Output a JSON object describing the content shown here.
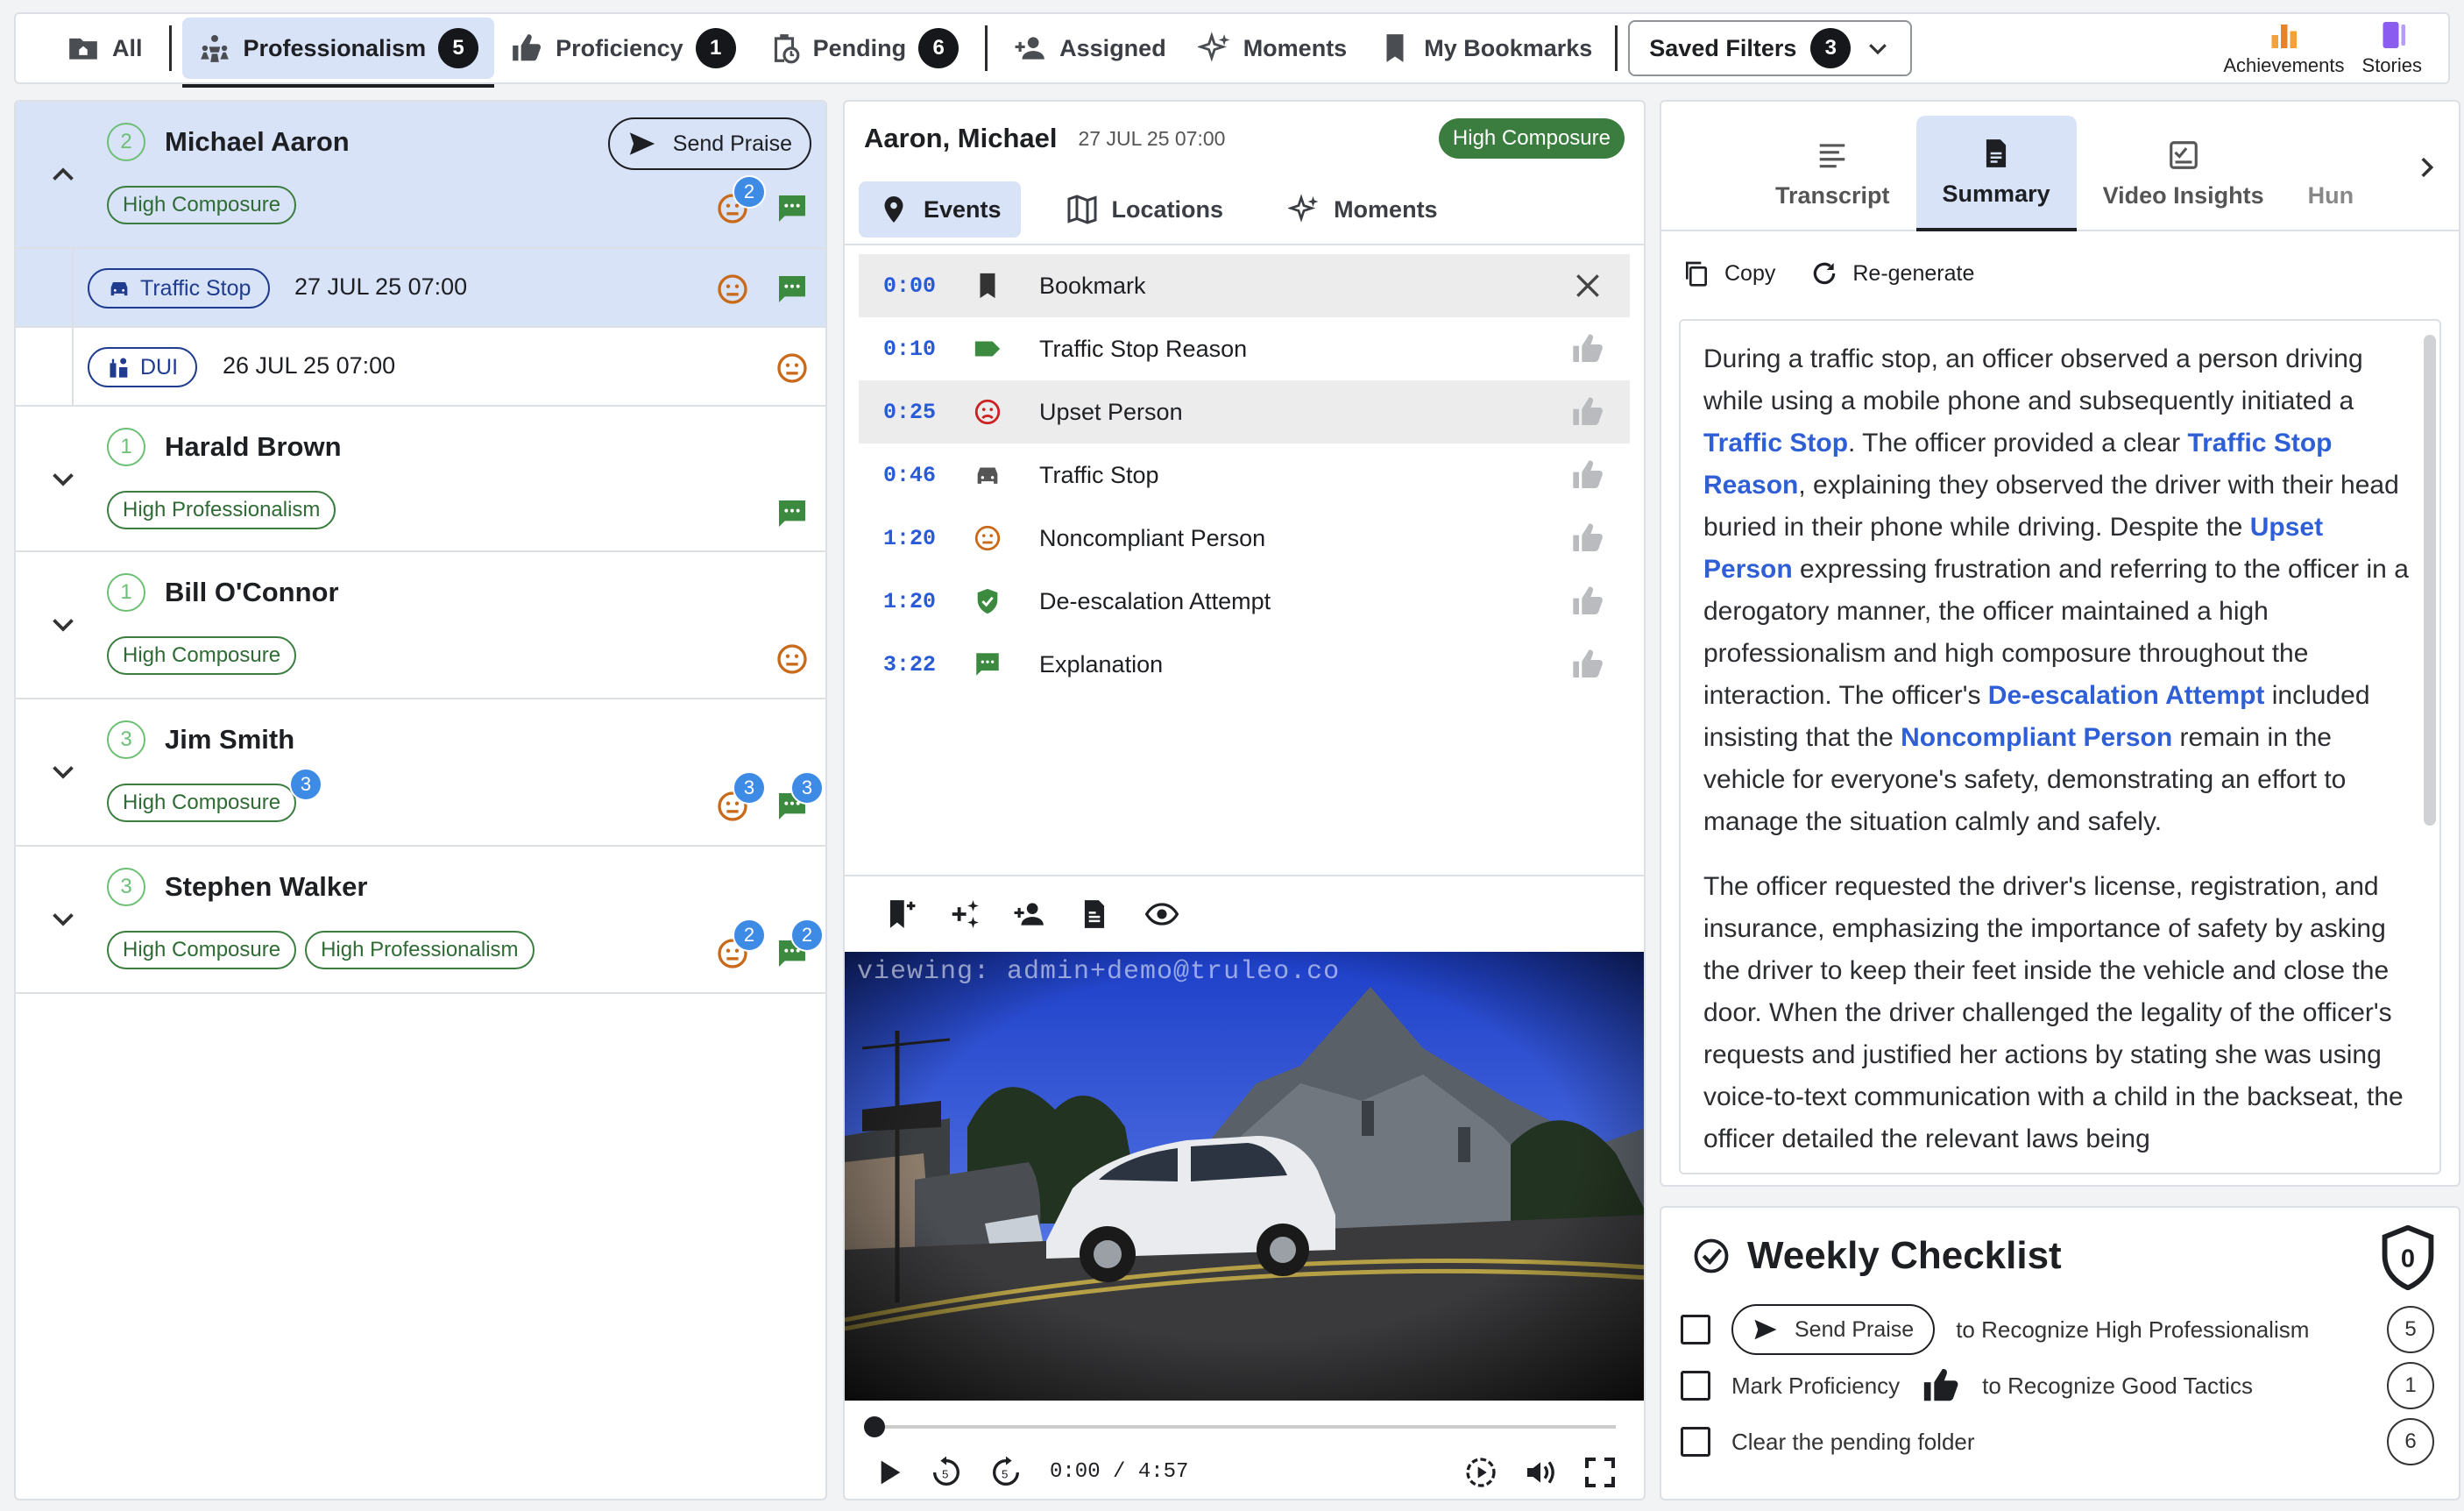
{
  "topbar": {
    "items": [
      {
        "label": "All",
        "icon": "folder-home-icon"
      },
      {
        "label": "Professionalism",
        "count": "5",
        "icon": "team-icon",
        "active": true
      },
      {
        "label": "Proficiency",
        "count": "1",
        "icon": "thumbs-up-icon"
      },
      {
        "label": "Pending",
        "count": "6",
        "icon": "clipboard-clock-icon"
      },
      {
        "label": "Assigned",
        "icon": "person-add-icon"
      },
      {
        "label": "Moments",
        "icon": "sparkle-icon"
      },
      {
        "label": "My Bookmarks",
        "icon": "bookmark-icon"
      }
    ],
    "saved_filters": {
      "label": "Saved Filters",
      "count": "3"
    },
    "right": [
      {
        "label": "Achievements"
      },
      {
        "label": "Stories"
      }
    ]
  },
  "people": [
    {
      "num": "2",
      "name": "Michael Aaron",
      "tags": [
        "High Composure"
      ],
      "praise": "Send Praise",
      "badge1": "2",
      "events": [
        {
          "type": "Traffic Stop",
          "date": "27 JUL 25 07:00"
        },
        {
          "type": "DUI",
          "date": "26 JUL 25 07:00"
        }
      ]
    },
    {
      "num": "1",
      "name": "Harald Brown",
      "tags": [
        "High Professionalism"
      ]
    },
    {
      "num": "1",
      "name": "Bill O'Connor",
      "tags": [
        "High Composure"
      ]
    },
    {
      "num": "3",
      "name": "Jim Smith",
      "tags": [
        "High Composure"
      ],
      "tag_badge": "3",
      "badge1": "3",
      "badge2": "3"
    },
    {
      "num": "3",
      "name": "Stephen Walker",
      "tags": [
        "High Composure",
        "High Professionalism"
      ],
      "badge1": "2",
      "badge2": "2"
    }
  ],
  "middle": {
    "name": "Aaron, Michael",
    "date": "27 JUL 25 07:00",
    "badge": "High Composure",
    "tabs": [
      "Events",
      "Locations",
      "Moments"
    ],
    "events": [
      {
        "time": "0:00",
        "label": "Bookmark",
        "icon": "bookmark-icon"
      },
      {
        "time": "0:10",
        "label": "Traffic Stop Reason",
        "icon": "tag-icon"
      },
      {
        "time": "0:25",
        "label": "Upset Person",
        "icon": "sad-face-icon"
      },
      {
        "time": "0:46",
        "label": "Traffic Stop",
        "icon": "car-icon"
      },
      {
        "time": "1:20",
        "label": "Noncompliant Person",
        "icon": "neutral-face-icon"
      },
      {
        "time": "1:20",
        "label": "De-escalation Attempt",
        "icon": "shield-check-icon"
      },
      {
        "time": "3:22",
        "label": "Explanation",
        "icon": "chat-icon"
      }
    ],
    "watermark": "viewing: admin+demo@truleo.co",
    "time": "0:00 / 4:57",
    "progress": 0
  },
  "right": {
    "tabs": [
      "Transcript",
      "Summary",
      "Video Insights",
      "Hun"
    ],
    "copy": "Copy",
    "regen": "Re-generate",
    "p1": [
      "During a traffic stop, an officer observed a person driving while using a mobile phone and subsequently initiated a ",
      "Traffic Stop",
      ". The officer provided a clear ",
      "Traffic Stop Reason",
      ", explaining they observed the driver with their head buried in their phone while driving. Despite the ",
      "Upset Person",
      " expressing frustration and referring to the officer in a derogatory manner, the officer maintained a high professionalism and high composure throughout the interaction. The officer's ",
      "De-escalation Attempt",
      " included insisting that the ",
      "Noncompliant Person",
      " remain in the vehicle for everyone's safety, demonstrating an effort to manage the situation calmly and safely."
    ],
    "p2": "The officer requested the driver's license, registration, and insurance, emphasizing the importance of safety by asking the driver to keep their feet inside the vehicle and close the door. When the driver challenged the legality of the officer's requests and justified her actions by stating she was using voice-to-text communication with a child in the backseat, the officer detailed the relevant laws being"
  },
  "checklist": {
    "title": "Weekly Checklist",
    "shield": "0",
    "r1": {
      "pill": "Send Praise",
      "text": "to Recognize High Professionalism",
      "count": "5"
    },
    "r2": {
      "a": "Mark Proficiency",
      "b": "to Recognize Good Tactics",
      "count": "1"
    },
    "r3": {
      "text": "Clear the pending folder",
      "count": "6"
    }
  }
}
